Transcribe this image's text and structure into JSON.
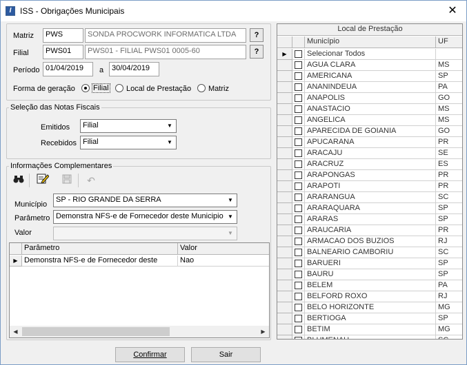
{
  "window": {
    "title": "ISS - Obrigações Municipais",
    "app_icon_glyph": "I"
  },
  "matriz": {
    "label": "Matriz",
    "code": "PWS",
    "name": "SONDA PROCWORK INFORMATICA LTDA",
    "lookup": "?"
  },
  "filial": {
    "label": "Filial",
    "code": "PWS01",
    "name": "PWS01 - FILIAL PWS01 0005-60",
    "lookup": "?"
  },
  "periodo": {
    "label": "Período",
    "start": "01/04/2019",
    "sep": "a",
    "end": "30/04/2019"
  },
  "forma": {
    "label": "Forma de geração",
    "options": [
      {
        "label": "Filial",
        "selected": true
      },
      {
        "label": "Local de Prestação",
        "selected": false
      },
      {
        "label": "Matriz",
        "selected": false
      }
    ]
  },
  "selecao": {
    "title": "Seleção das Notas Fiscais",
    "emitidos_label": "Emitidos",
    "emitidos_value": "Filial",
    "recebidos_label": "Recebidos",
    "recebidos_value": "Filial"
  },
  "info": {
    "title": "Informações Complementares",
    "toolbar": [
      "binoculars-icon",
      "edit-icon",
      "save-icon",
      "undo-icon"
    ],
    "municipio_label": "Município",
    "municipio_value": "SP - RIO GRANDE DA SERRA",
    "parametro_label": "Parâmetro",
    "parametro_value": "Demonstra NFS-e de Fornecedor deste Municipio",
    "valor_label": "Valor",
    "valor_value": "",
    "grid": {
      "columns": [
        "Parâmetro",
        "Valor"
      ],
      "rows": [
        {
          "parametro": "Demonstra NFS-e de Fornecedor deste",
          "valor": "Nao"
        }
      ]
    }
  },
  "local": {
    "title": "Local de Prestação",
    "columns": [
      "Município",
      "UF"
    ],
    "rows": [
      {
        "municipio": "Selecionar Todos",
        "uf": ""
      },
      {
        "municipio": "AGUA CLARA",
        "uf": "MS"
      },
      {
        "municipio": "AMERICANA",
        "uf": "SP"
      },
      {
        "municipio": "ANANINDEUA",
        "uf": "PA"
      },
      {
        "municipio": "ANAPOLIS",
        "uf": "GO"
      },
      {
        "municipio": "ANASTACIO",
        "uf": "MS"
      },
      {
        "municipio": "ANGELICA",
        "uf": "MS"
      },
      {
        "municipio": "APARECIDA DE GOIANIA",
        "uf": "GO"
      },
      {
        "municipio": "APUCARANA",
        "uf": "PR"
      },
      {
        "municipio": "ARACAJU",
        "uf": "SE"
      },
      {
        "municipio": "ARACRUZ",
        "uf": "ES"
      },
      {
        "municipio": "ARAPONGAS",
        "uf": "PR"
      },
      {
        "municipio": "ARAPOTI",
        "uf": "PR"
      },
      {
        "municipio": "ARARANGUA",
        "uf": "SC"
      },
      {
        "municipio": "ARARAQUARA",
        "uf": "SP"
      },
      {
        "municipio": "ARARAS",
        "uf": "SP"
      },
      {
        "municipio": "ARAUCARIA",
        "uf": "PR"
      },
      {
        "municipio": "ARMACAO DOS BUZIOS",
        "uf": "RJ"
      },
      {
        "municipio": "BALNEARIO CAMBORIU",
        "uf": "SC"
      },
      {
        "municipio": "BARUERI",
        "uf": "SP"
      },
      {
        "municipio": "BAURU",
        "uf": "SP"
      },
      {
        "municipio": "BELEM",
        "uf": "PA"
      },
      {
        "municipio": "BELFORD ROXO",
        "uf": "RJ"
      },
      {
        "municipio": "BELO HORIZONTE",
        "uf": "MG"
      },
      {
        "municipio": "BERTIOGA",
        "uf": "SP"
      },
      {
        "municipio": "BETIM",
        "uf": "MG"
      },
      {
        "municipio": "BLUMENAU",
        "uf": "SC"
      }
    ]
  },
  "buttons": {
    "confirmar": "Confirmar",
    "sair": "Sair"
  }
}
